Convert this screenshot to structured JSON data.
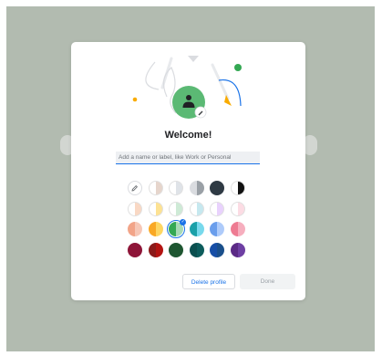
{
  "dialog": {
    "title": "Welcome!",
    "name_input": {
      "placeholder": "Add a name or label, like Work or Personal",
      "value": ""
    },
    "delete_button": "Delete profile",
    "done_button": "Done",
    "avatar": {
      "icon": "person-icon",
      "edit_icon": "pencil-icon"
    }
  },
  "colors": {
    "accent": "#1a73e8",
    "avatar_bg": "#5bb974",
    "backdrop": "#b2bbb0"
  },
  "color_picker": {
    "custom_icon": "pencil-icon",
    "swatches": [
      {
        "left": "#ffffff",
        "right": "#dadce0"
      },
      {
        "left": "#ffffff",
        "right": "#e6d5cc"
      },
      {
        "left": "#ffffff",
        "right": "#dfe3e8"
      },
      {
        "left": "#dadce0",
        "right": "#9aa0a6"
      },
      {
        "left": "#2f3a44",
        "right": "#2f3a44"
      },
      {
        "left": "#ffffff",
        "right": "#111111"
      },
      {
        "left": "#ffffff",
        "right": "#f9d8c4"
      },
      {
        "left": "#ffffff",
        "right": "#fde293"
      },
      {
        "left": "#ffffff",
        "right": "#ceead6"
      },
      {
        "left": "#ffffff",
        "right": "#c6e8ef"
      },
      {
        "left": "#ffffff",
        "right": "#e9d2fd"
      },
      {
        "left": "#ffffff",
        "right": "#fcdce4"
      },
      {
        "left": "#f2a488",
        "right": "#f6c7b6"
      },
      {
        "left": "#f9a825",
        "right": "#fdd663"
      },
      {
        "left": "#34a853",
        "right": "#a8dab5",
        "selected": true
      },
      {
        "left": "#1aa0a8",
        "right": "#78d9ec"
      },
      {
        "left": "#6a9eec",
        "right": "#aecbfa"
      },
      {
        "left": "#ee7b92",
        "right": "#f6aebe"
      },
      {
        "left": "#8e1538",
        "right": "#8e1538"
      },
      {
        "left": "#8b1a1a",
        "right": "#b31412"
      },
      {
        "left": "#1e5631",
        "right": "#1e5631"
      },
      {
        "left": "#0b4f4f",
        "right": "#0d5c5c"
      },
      {
        "left": "#174ea6",
        "right": "#1a4f8b"
      },
      {
        "left": "#5b2a86",
        "right": "#6e3fa3"
      }
    ]
  }
}
